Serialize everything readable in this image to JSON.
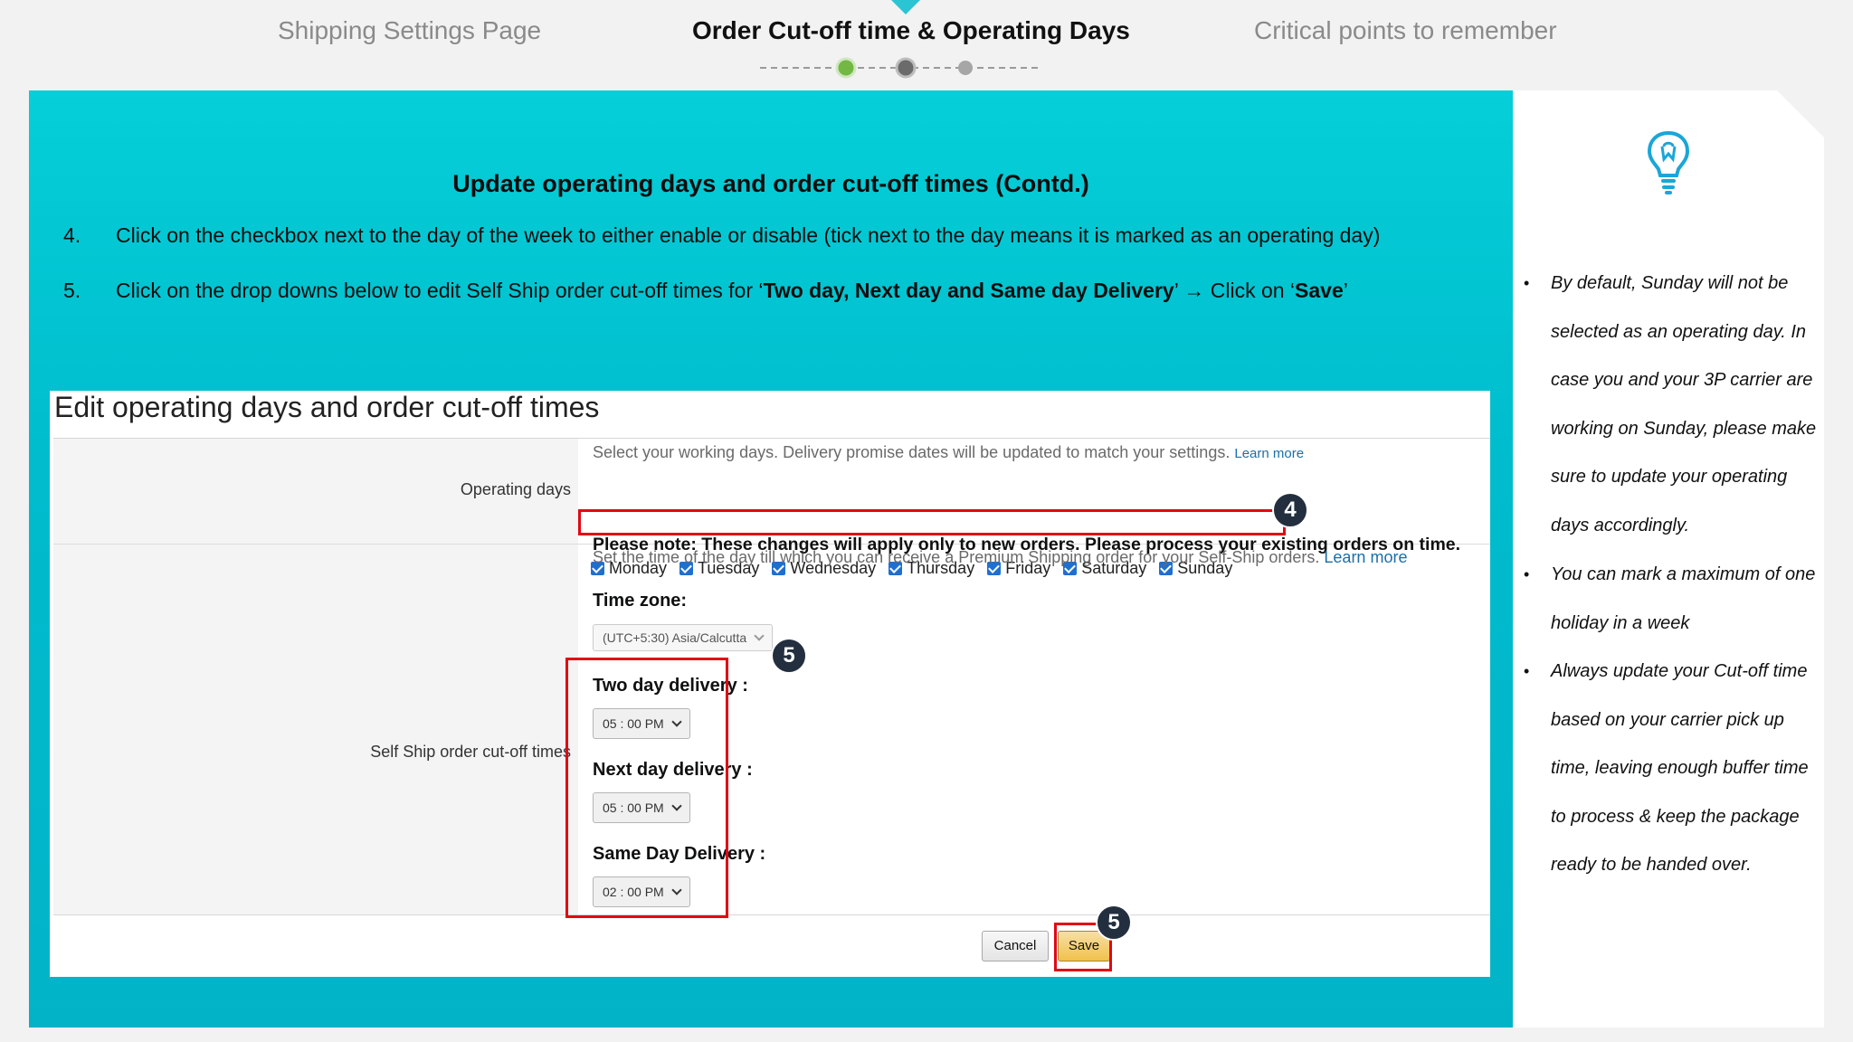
{
  "nav": {
    "tabs": [
      {
        "label": "Shipping Settings Page"
      },
      {
        "label": "Order Cut-off time & Operating Days"
      },
      {
        "label": "Critical points to remember"
      }
    ]
  },
  "slide": {
    "heading": "Update operating days and order cut-off times (Contd.)",
    "steps": [
      {
        "num": "4.",
        "text": "Click on the checkbox next to the day of the week to either enable or disable (tick next to the day means it is marked as an operating day)"
      },
      {
        "num": "5.",
        "text_a": "Click on the drop downs below to edit Self Ship order cut-off times for ‘",
        "bold_a": "Two day, Next day and Same day Delivery",
        "text_b": "’ → Click on ‘",
        "bold_b": "Save",
        "text_c": "’"
      }
    ]
  },
  "screenshot": {
    "title": "Edit operating days and order cut-off times",
    "operating_days": {
      "label": "Operating days",
      "hint": "Select your working days. Delivery promise dates will be updated to match your settings.",
      "learn_more": "Learn more",
      "note": "Please note: These changes will apply only to new orders. Please process your existing orders on time.",
      "days": [
        "Monday",
        "Tuesday",
        "Wednesday",
        "Thursday",
        "Friday",
        "Saturday",
        "Sunday"
      ]
    },
    "cutoff": {
      "label": "Self Ship order cut-off times",
      "hint": "Set the time of the day till which you can receive a Premium Shipping order for your Self-Ship orders.",
      "learn_more": "Learn more",
      "timezone_label": "Time zone:",
      "timezone_value": "(UTC+5:30) Asia/Calcutta",
      "two_day_label": "Two day delivery :",
      "two_day_value": "05 : 00 PM",
      "next_day_label": "Next day delivery :",
      "next_day_value": "05 : 00 PM",
      "same_day_label": "Same Day Delivery :",
      "same_day_value": "02 : 00 PM"
    },
    "buttons": {
      "cancel": "Cancel",
      "save": "Save"
    },
    "badges": {
      "step4": "4",
      "step5a": "5",
      "step5b": "5"
    }
  },
  "tips": {
    "icon": "lightbulb-icon",
    "items": [
      {
        "text": "By default, Sunday will not be selected as an operating day. In case you and your 3P carrier are working on Sunday, please make sure to update your operating days accordingly."
      },
      {
        "text": "You can mark a maximum of one holiday in a week"
      },
      {
        "text": "Always update your Cut-off time based on your carrier pick up time, leaving enough buffer time to process & keep the package ready to be handed over."
      }
    ]
  },
  "colors": {
    "teal": "#00bccd",
    "highlight_red": "#e30613",
    "badge": "#232f3e",
    "save_button": "#f0c14b"
  }
}
